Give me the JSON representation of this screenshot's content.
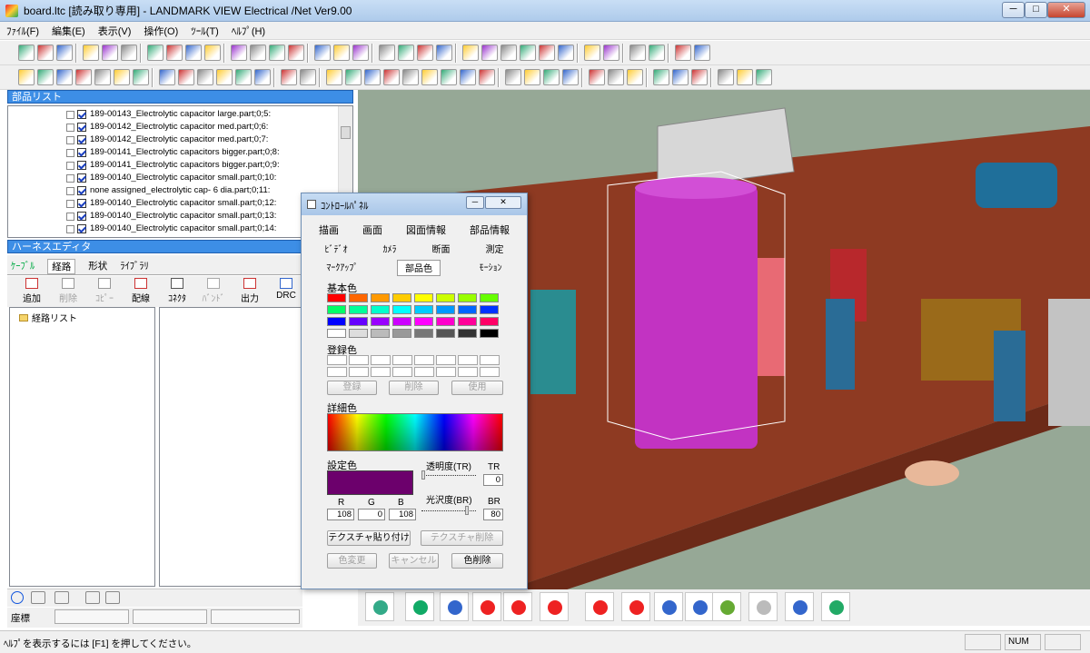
{
  "window": {
    "title": "board.ltc [読み取り専用] - LANDMARK VIEW Electrical /Net Ver9.00",
    "min": "─",
    "max": "□",
    "close": "✕"
  },
  "menu": [
    "ﾌｧｲﾙ(F)",
    "編集(E)",
    "表示(V)",
    "操作(O)",
    "ﾂｰﾙ(T)",
    "ﾍﾙﾌﾟ(H)"
  ],
  "parts_list": {
    "title": "部品リスト",
    "items": [
      "189-00143_Electrolytic capacitor large.part;0;5:",
      "189-00142_Electrolytic capacitor med.part;0;6:",
      "189-00142_Electrolytic capacitor med.part;0;7:",
      "189-00141_Electrolytic capacitors bigger.part;0;8:",
      "189-00141_Electrolytic capacitors bigger.part;0;9:",
      "189-00140_Electrolytic capacitor small.part;0;10:",
      "none assigned_electrolytic  cap- 6 dia.part;0;11:",
      "189-00140_Electrolytic capacitor small.part;0;12:",
      "189-00140_Electrolytic capacitor small.part;0;13:",
      "189-00140_Electrolytic capacitor small.part;0;14:"
    ]
  },
  "harness": {
    "title": "ハーネスエディタ",
    "tabs": [
      "ｹｰﾌﾞﾙ",
      "経路",
      "形状",
      "ﾗｲﾌﾞﾗﾘ"
    ],
    "buttons": [
      "追加",
      "削除",
      "ｺﾋﾟｰ",
      "配線",
      "ｺﾈｸﾀ",
      "ﾊﾞﾝﾄﾞ",
      "出力",
      "DRC"
    ],
    "tree_root": "経路リスト",
    "coord_label": "座標"
  },
  "status": {
    "help": "ﾍﾙﾌﾟを表示するには [F1] を押してください。",
    "num": "NUM"
  },
  "control_panel": {
    "title": "ｺﾝﾄﾛｰﾙﾊﾟﾈﾙ",
    "tabs_row1": [
      "描画",
      "画面",
      "図面情報",
      "部品情報"
    ],
    "tabs_row2": [
      "ﾋﾞﾃﾞｵ",
      "ｶﾒﾗ",
      "断面",
      "測定"
    ],
    "tabs_row3": [
      "ﾏｰｸｱｯﾌﾟ",
      "部品色",
      "ﾓｰｼｮﾝ"
    ],
    "basic_label": "基本色",
    "registered_label": "登録色",
    "btn_register": "登録",
    "btn_delete": "削除",
    "btn_use": "使用",
    "detail_label": "詳細色",
    "setting_label": "設定色",
    "transparency_label": "透明度(TR)",
    "tr_short": "TR",
    "tr_value": "0",
    "gloss_label": "光沢度(BR)",
    "br_short": "BR",
    "br_value": "80",
    "r_label": "R",
    "g_label": "G",
    "b_label": "B",
    "r_value": "108",
    "g_value": "0",
    "b_value": "108",
    "btn_texture": "テクスチャ貼り付け",
    "btn_texture_del": "テクスチャ削除",
    "btn_color_change": "色変更",
    "btn_cancel": "キャンセル",
    "btn_color_delete": "色削除",
    "current_color": "#6c006c",
    "basic_colors": [
      "#ff0000",
      "#ff6600",
      "#ff9900",
      "#ffcc00",
      "#ffff00",
      "#ccff00",
      "#99ff00",
      "#66ff00",
      "#00ff66",
      "#00ff99",
      "#00ffcc",
      "#00ffff",
      "#00ccff",
      "#0099ff",
      "#0066ff",
      "#0033ff",
      "#0000ff",
      "#6600ff",
      "#9900ff",
      "#cc00ff",
      "#ff00ff",
      "#ff00cc",
      "#ff0099",
      "#ff0066",
      "#ffffff",
      "#dddddd",
      "#bbbbbb",
      "#999999",
      "#777777",
      "#555555",
      "#333333",
      "#000000"
    ]
  }
}
